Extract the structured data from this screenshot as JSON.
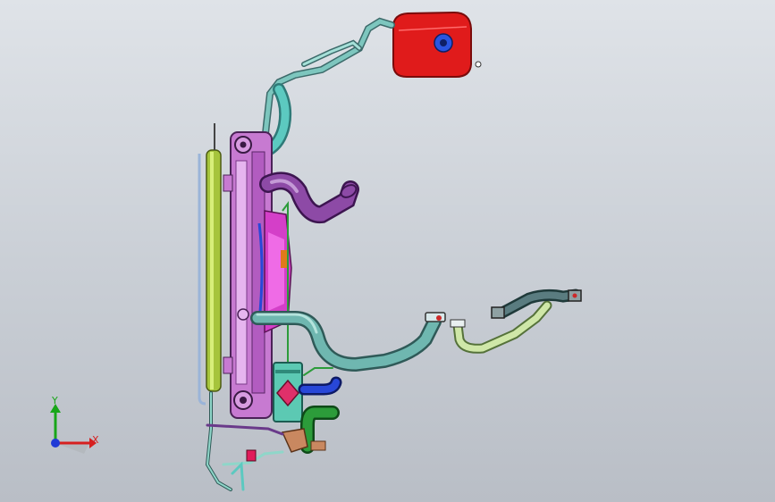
{
  "viewport": {
    "background_top": "#dfe3e8",
    "background_bottom": "#b9bec6"
  },
  "triad": {
    "x_label": "X",
    "y_label": "Y",
    "x_color": "#d61f1f",
    "y_color": "#18a618",
    "z_color": "#1f3ad6"
  },
  "model": {
    "radiator_color": "#c77ad1",
    "tank_color": "#e01b1b",
    "hose_color": "#6fb7b0",
    "rod_color": "#a6c43c",
    "purple_hose_color": "#8d4aa6",
    "green_hose_color": "#2c9c3a",
    "blue_hose_color": "#2847d8",
    "pale_hose_color": "#cfe7a8"
  }
}
